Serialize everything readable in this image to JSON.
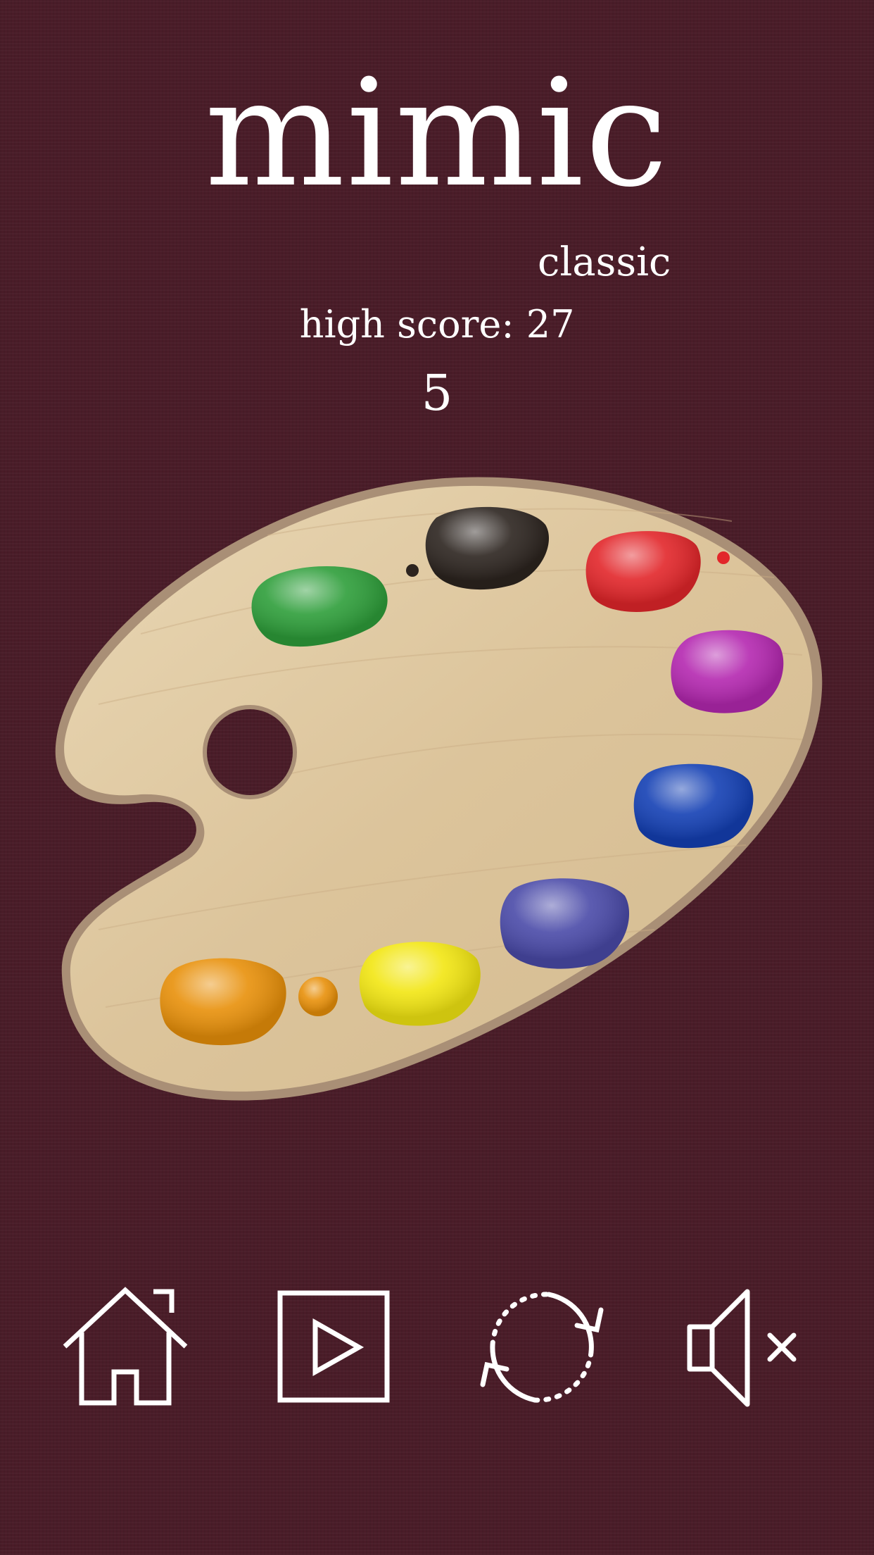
{
  "header": {
    "title": "mimic",
    "mode": "classic",
    "high_score": "high score: 27",
    "score": "5"
  },
  "palette": {
    "paints": [
      {
        "name": "green",
        "color": "#2e9e3a"
      },
      {
        "name": "black",
        "color": "#2c241f"
      },
      {
        "name": "red",
        "color": "#e2262a"
      },
      {
        "name": "magenta",
        "color": "#b428b0"
      },
      {
        "name": "blue",
        "color": "#1440b4"
      },
      {
        "name": "indigo",
        "color": "#4a4aa8"
      },
      {
        "name": "yellow",
        "color": "#f2e612"
      },
      {
        "name": "orange",
        "color": "#e8900a"
      }
    ]
  },
  "toolbar": {
    "buttons": [
      {
        "icon": "home-icon"
      },
      {
        "icon": "play-icon"
      },
      {
        "icon": "restart-icon"
      },
      {
        "icon": "mute-icon"
      }
    ]
  },
  "colors": {
    "background": "#4a1c28",
    "wood": "#dfc9a2",
    "text": "#ffffff"
  }
}
